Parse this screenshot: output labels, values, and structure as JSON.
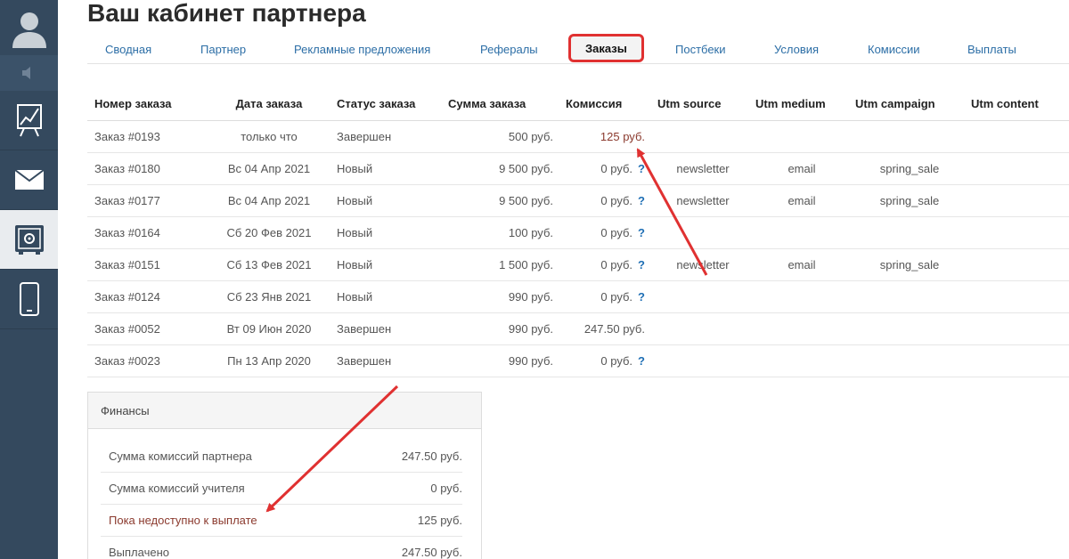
{
  "page": {
    "title": "Ваш кабинет партнера"
  },
  "tabs": [
    {
      "label": "Сводная",
      "active": false
    },
    {
      "label": "Партнер",
      "active": false
    },
    {
      "label": "Рекламные предложения",
      "active": false
    },
    {
      "label": "Рефералы",
      "active": false
    },
    {
      "label": "Заказы",
      "active": true
    },
    {
      "label": "Постбеки",
      "active": false
    },
    {
      "label": "Условия",
      "active": false
    },
    {
      "label": "Комиссии",
      "active": false
    },
    {
      "label": "Выплаты",
      "active": false
    }
  ],
  "orders": {
    "headers": [
      "Номер заказа",
      "Дата заказа",
      "Статус заказа",
      "Сумма заказа",
      "Комиссия",
      "Utm source",
      "Utm medium",
      "Utm campaign",
      "Utm content"
    ],
    "rows": [
      {
        "number": "Заказ #0193",
        "date": "только что",
        "status": "Завершен",
        "sum": "500 руб.",
        "commission": "125 руб.",
        "help": "",
        "source": "",
        "medium": "",
        "campaign": "",
        "content": ""
      },
      {
        "number": "Заказ #0180",
        "date": "Вс 04 Апр 2021",
        "status": "Новый",
        "sum": "9 500 руб.",
        "commission": "0 руб.",
        "help": "?",
        "source": "newsletter",
        "medium": "email",
        "campaign": "spring_sale",
        "content": ""
      },
      {
        "number": "Заказ #0177",
        "date": "Вс 04 Апр 2021",
        "status": "Новый",
        "sum": "9 500 руб.",
        "commission": "0 руб.",
        "help": "?",
        "source": "newsletter",
        "medium": "email",
        "campaign": "spring_sale",
        "content": ""
      },
      {
        "number": "Заказ #0164",
        "date": "Сб 20 Фев 2021",
        "status": "Новый",
        "sum": "100 руб.",
        "commission": "0 руб.",
        "help": "?",
        "source": "",
        "medium": "",
        "campaign": "",
        "content": ""
      },
      {
        "number": "Заказ #0151",
        "date": "Сб 13 Фев 2021",
        "status": "Новый",
        "sum": "1 500 руб.",
        "commission": "0 руб.",
        "help": "?",
        "source": "newsletter",
        "medium": "email",
        "campaign": "spring_sale",
        "content": ""
      },
      {
        "number": "Заказ #0124",
        "date": "Сб 23 Янв 2021",
        "status": "Новый",
        "sum": "990 руб.",
        "commission": "0 руб.",
        "help": "?",
        "source": "",
        "medium": "",
        "campaign": "",
        "content": ""
      },
      {
        "number": "Заказ #0052",
        "date": "Вт 09 Июн 2020",
        "status": "Завершен",
        "sum": "990 руб.",
        "commission": "247.50 руб.",
        "help": "",
        "source": "",
        "medium": "",
        "campaign": "",
        "content": ""
      },
      {
        "number": "Заказ #0023",
        "date": "Пн 13 Апр 2020",
        "status": "Завершен",
        "sum": "990 руб.",
        "commission": "0 руб.",
        "help": "?",
        "source": "",
        "medium": "",
        "campaign": "",
        "content": ""
      }
    ]
  },
  "finance": {
    "title": "Финансы",
    "rows": [
      {
        "label": "Сумма комиссий партнера",
        "value": "247.50 руб."
      },
      {
        "label": "Сумма комиссий учителя",
        "value": "0 руб."
      },
      {
        "label": "Пока недоступно к выплате",
        "value": "125 руб."
      },
      {
        "label": "Выплачено",
        "value": "247.50 руб."
      }
    ]
  },
  "sidebar": {
    "icons": [
      "avatar-icon",
      "speaker-icon",
      "chart-icon",
      "mail-icon",
      "safe-icon",
      "phone-icon"
    ]
  },
  "colors": {
    "sidebar": "#34495e",
    "accent_red": "#e03131",
    "link": "#2c6ea6",
    "warn_text": "#8b3a2e"
  }
}
